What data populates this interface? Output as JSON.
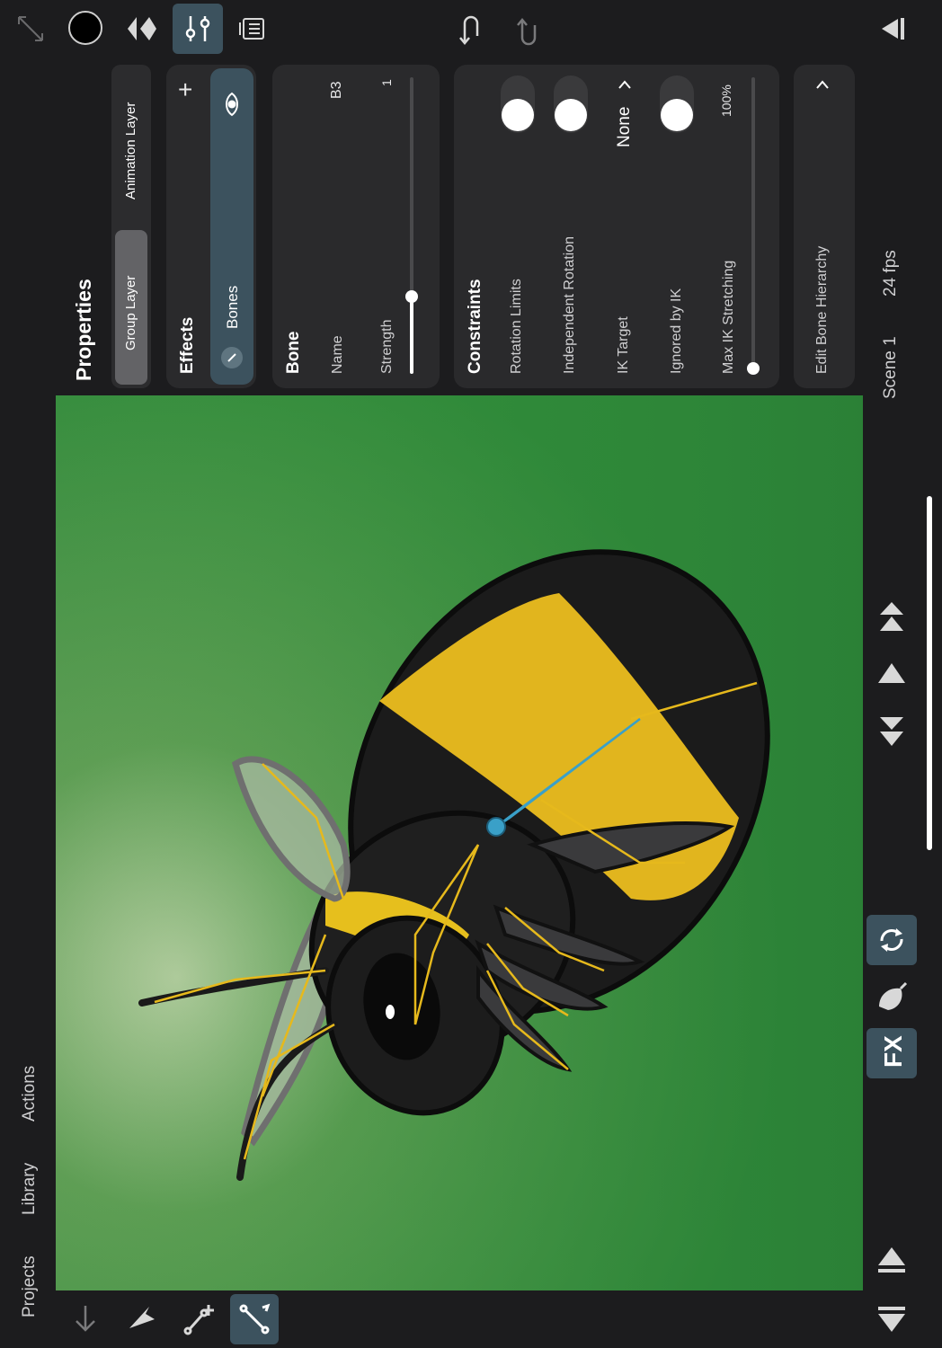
{
  "nav": {
    "projects": "Projects",
    "library": "Library",
    "actions": "Actions"
  },
  "panel": {
    "title": "Properties",
    "layer_tabs": {
      "group": "Group Layer",
      "animation": "Animation Layer",
      "selected": "Group Layer"
    },
    "effects": {
      "title": "Effects",
      "add": "+",
      "item": "Bones"
    },
    "bone": {
      "title": "Bone",
      "name_label": "Name",
      "name_value": "B3",
      "strength_label": "Strength",
      "strength_value": "1",
      "strength_level": 0.26
    },
    "constraints": {
      "title": "Constraints",
      "rotation_limits": "Rotation Limits",
      "independent_rotation": "Independent Rotation",
      "ik_target": "IK Target",
      "ik_target_value": "None",
      "ignored_by_ik": "Ignored by IK",
      "max_ik_stretching": "Max IK Stretching",
      "max_ik_value": "100%",
      "max_ik_level": 0.0
    },
    "edit_bone_hierarchy": "Edit Bone Hierarchy"
  },
  "status": {
    "scene": "Scene 1",
    "fps": "24 fps"
  },
  "bottom": {
    "fx": "FX"
  },
  "colors": {
    "accent": "#3c525e",
    "canvas_green": "#2f8a3a",
    "bee_yellow": "#e6b91c",
    "bone_blue": "#3aa0c8"
  }
}
